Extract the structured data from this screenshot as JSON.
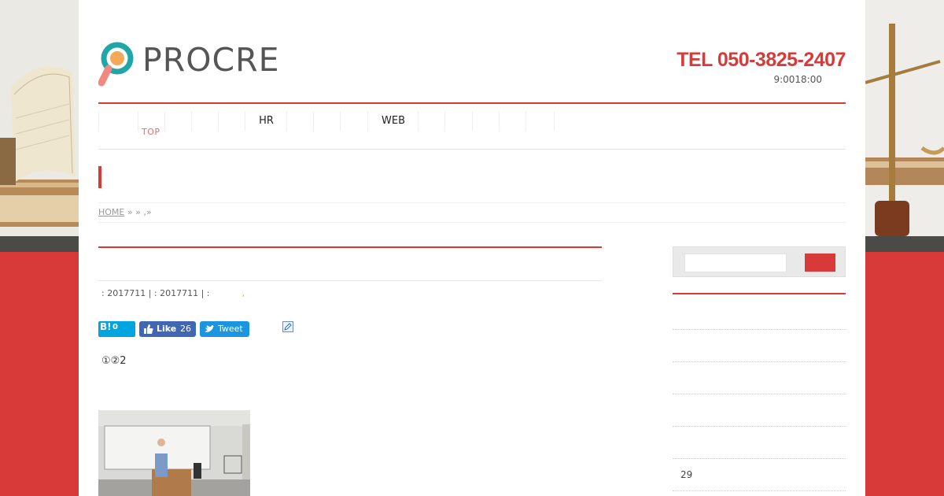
{
  "brand": {
    "name": "PROCRE"
  },
  "header": {
    "tel": "TEL 050-3825-2407",
    "hours": "9:0018:00"
  },
  "nav": {
    "items": [
      "HR",
      "WEB"
    ],
    "top_label": "TOP"
  },
  "breadcrumb": {
    "home": "HOME",
    "rest": " »  » ,» "
  },
  "post": {
    "meta": ": 2017711 | : 2017711 | :",
    "meta_dot": ",",
    "content_text": "①②2"
  },
  "social": {
    "hatena_label": "B!",
    "hatena_count": "0",
    "fb_label": "Like",
    "fb_count": "26",
    "tweet_label": "Tweet"
  },
  "sidebar": {
    "number": "29"
  },
  "colors": {
    "accent": "#d83a3a",
    "nav_top": "#e07070",
    "hatena": "#00a4de",
    "facebook": "#4267b2",
    "twitter": "#1b95e0"
  },
  "icons": {
    "logo": "magnifier-logo-icon",
    "edit": "pencil-icon",
    "thumbs": "thumbs-up-icon",
    "bird": "twitter-bird-icon"
  }
}
